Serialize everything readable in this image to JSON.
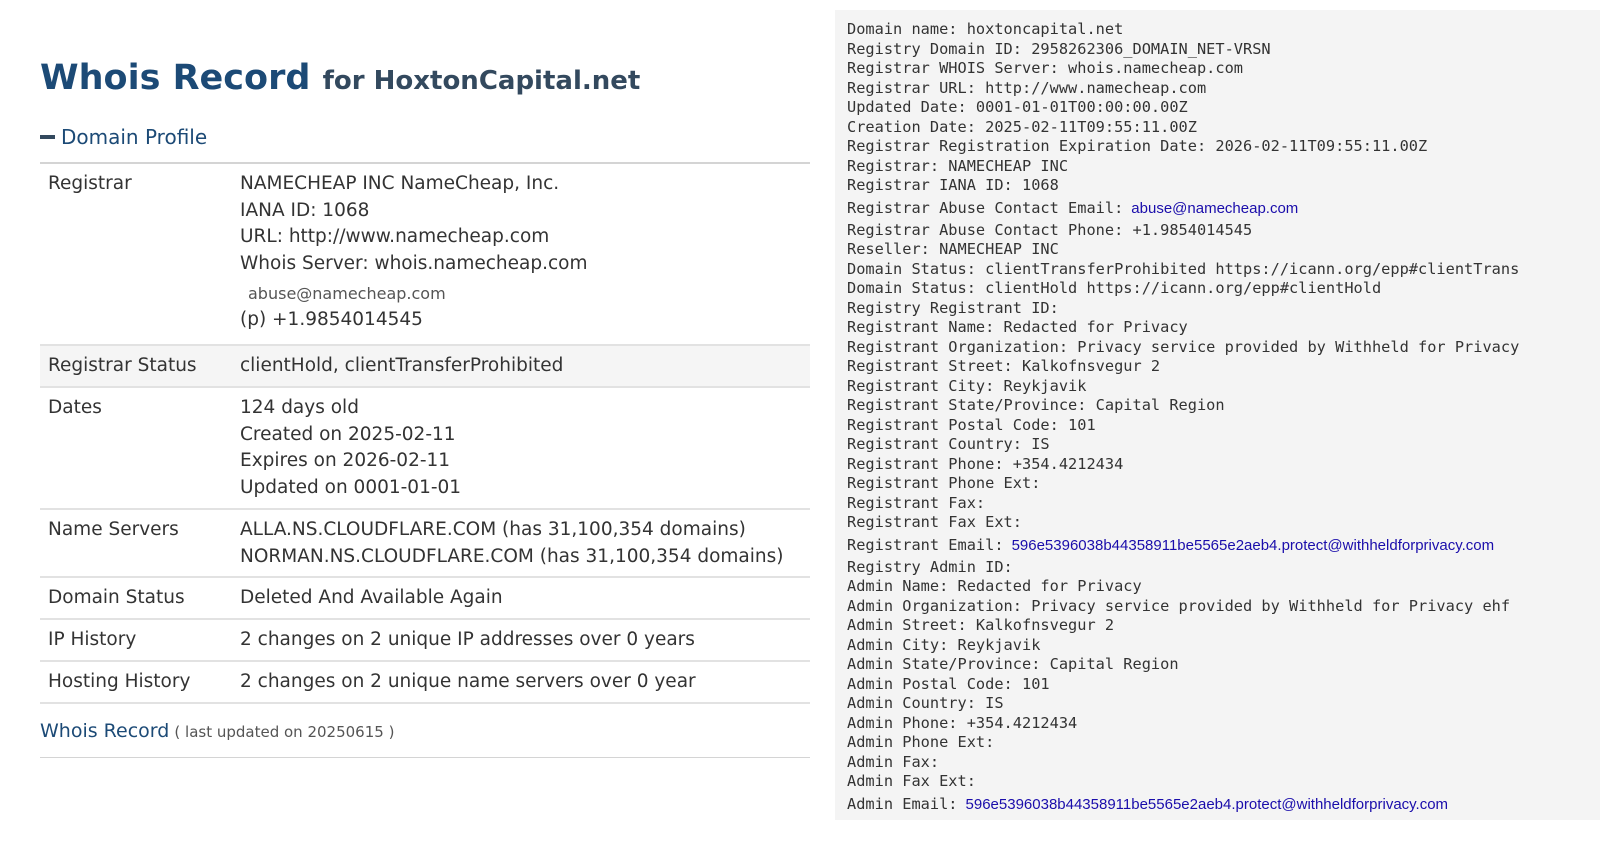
{
  "title": {
    "main": "Whois Record",
    "domain_part": "for HoxtonCapital.net"
  },
  "section_toggle": "Domain Profile",
  "profile": [
    {
      "label": "Registrar",
      "alt": false,
      "lines": [
        "NAMECHEAP INC NameCheap, Inc.",
        "IANA ID: 1068",
        "URL: http://www.namecheap.com",
        "Whois Server: whois.namecheap.com",
        "abuse@namecheap.com",
        "(p) +1.9854014545"
      ]
    },
    {
      "label": "Registrar Status",
      "alt": true,
      "lines": [
        "clientHold, clientTransferProhibited"
      ]
    },
    {
      "label": "Dates",
      "alt": false,
      "lines": [
        "124 days old",
        "Created on 2025-02-11",
        "Expires on 2026-02-11",
        "Updated on 0001-01-01"
      ]
    },
    {
      "label": "Name Servers",
      "alt": false,
      "lines": [
        "ALLA.NS.CLOUDFLARE.COM (has 31,100,354 domains)",
        "NORMAN.NS.CLOUDFLARE.COM (has 31,100,354 domains)"
      ]
    },
    {
      "label": "Domain Status",
      "alt": false,
      "lines": [
        "Deleted And Available Again"
      ]
    },
    {
      "label": "IP History",
      "alt": false,
      "lines": [
        "2 changes on 2 unique IP addresses over 0 years"
      ]
    },
    {
      "label": "Hosting History",
      "alt": false,
      "lines": [
        "2 changes on 2 unique name servers over 0 year"
      ]
    }
  ],
  "footer": {
    "link": "Whois Record",
    "meta": "( last updated on 20250615 )"
  },
  "raw_record": [
    {
      "text": "Domain name: hoxtoncapital.net"
    },
    {
      "text": "Registry Domain ID: 2958262306_DOMAIN_NET-VRSN"
    },
    {
      "text": "Registrar WHOIS Server: whois.namecheap.com"
    },
    {
      "text": "Registrar URL: http://www.namecheap.com"
    },
    {
      "text": "Updated Date: 0001-01-01T00:00:00.00Z"
    },
    {
      "text": "Creation Date: 2025-02-11T09:55:11.00Z"
    },
    {
      "text": "Registrar Registration Expiration Date: 2026-02-11T09:55:11.00Z"
    },
    {
      "text": "Registrar: NAMECHEAP INC"
    },
    {
      "text": "Registrar IANA ID: 1068"
    },
    {
      "text": "Registrar Abuse Contact Email:",
      "email": "abuse@namecheap.com"
    },
    {
      "text": "Registrar Abuse Contact Phone: +1.9854014545"
    },
    {
      "text": "Reseller: NAMECHEAP INC"
    },
    {
      "text": "Domain Status: clientTransferProhibited https://icann.org/epp#clientTrans"
    },
    {
      "text": "Domain Status: clientHold https://icann.org/epp#clientHold"
    },
    {
      "text": "Registry Registrant ID:"
    },
    {
      "text": "Registrant Name: Redacted for Privacy"
    },
    {
      "text": "Registrant Organization: Privacy service provided by Withheld for Privacy"
    },
    {
      "text": "Registrant Street: Kalkofnsvegur 2"
    },
    {
      "text": "Registrant City: Reykjavik"
    },
    {
      "text": "Registrant State/Province: Capital Region"
    },
    {
      "text": "Registrant Postal Code: 101"
    },
    {
      "text": "Registrant Country: IS"
    },
    {
      "text": "Registrant Phone: +354.4212434"
    },
    {
      "text": "Registrant Phone Ext:"
    },
    {
      "text": "Registrant Fax:"
    },
    {
      "text": "Registrant Fax Ext:"
    },
    {
      "text": "Registrant Email:",
      "email": "596e5396038b44358911be5565e2aeb4.protect@withheldforprivacy.com"
    },
    {
      "text": "Registry Admin ID:"
    },
    {
      "text": "Admin Name: Redacted for Privacy"
    },
    {
      "text": "Admin Organization: Privacy service provided by Withheld for Privacy ehf"
    },
    {
      "text": "Admin Street: Kalkofnsvegur 2"
    },
    {
      "text": "Admin City: Reykjavik"
    },
    {
      "text": "Admin State/Province: Capital Region"
    },
    {
      "text": "Admin Postal Code: 101"
    },
    {
      "text": "Admin Country: IS"
    },
    {
      "text": "Admin Phone: +354.4212434"
    },
    {
      "text": "Admin Phone Ext:"
    },
    {
      "text": "Admin Fax:"
    },
    {
      "text": "Admin Fax Ext:"
    },
    {
      "text": "Admin Email:",
      "email": "596e5396038b44358911be5565e2aeb4.protect@withheldforprivacy.com"
    }
  ],
  "colors": {
    "heading": "#1c4a76",
    "email_link": "#1a0dab",
    "raw_bg": "#f4f4f4"
  }
}
